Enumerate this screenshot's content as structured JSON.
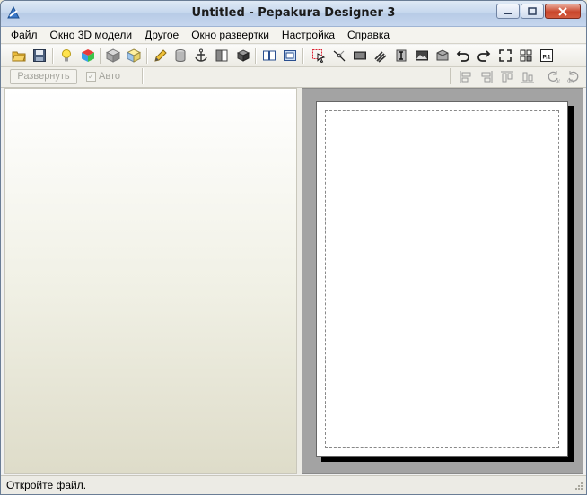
{
  "window": {
    "title": "Untitled - Pepakura Designer 3"
  },
  "menu": {
    "items": [
      {
        "label": "Файл"
      },
      {
        "label": "Окно 3D модели"
      },
      {
        "label": "Другое"
      },
      {
        "label": "Окно развертки"
      },
      {
        "label": "Настройка"
      },
      {
        "label": "Справка"
      }
    ]
  },
  "toolbar2": {
    "expand_label": "Развернуть",
    "auto_label": "Авто",
    "auto_checked": "✓"
  },
  "rotate_labels": {
    "ccw": "90",
    "cw": "90"
  },
  "page_label": "P.1",
  "status": {
    "text": "Откройте файл."
  },
  "colors": {
    "title_gradient": "#c7d8ee",
    "close_button": "#c9462c",
    "panel_bg": "#a3a3a3"
  }
}
